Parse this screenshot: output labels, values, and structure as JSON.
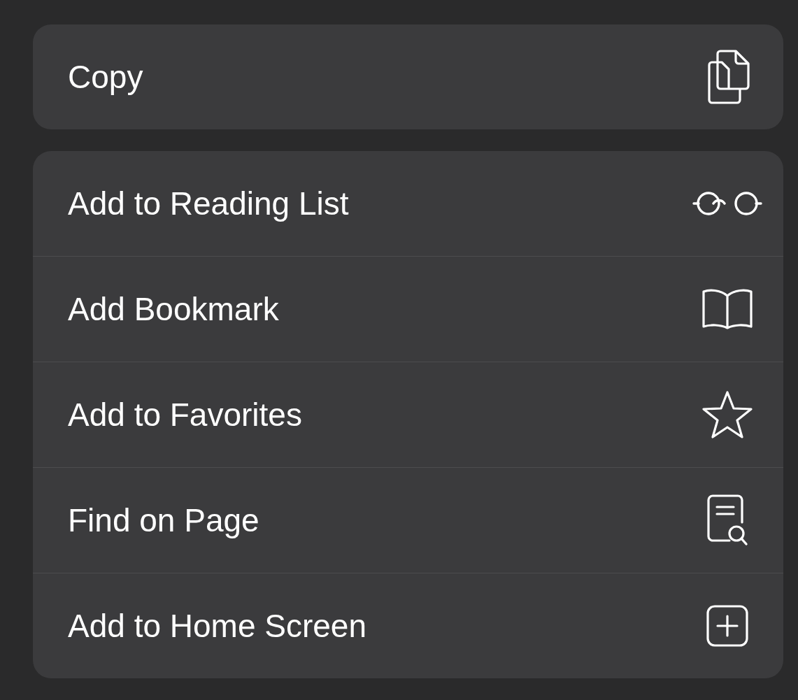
{
  "groups": [
    {
      "items": [
        {
          "label": "Copy",
          "kind": "copy"
        }
      ]
    },
    {
      "items": [
        {
          "label": "Add to Reading List",
          "kind": "glasses"
        },
        {
          "label": "Add Bookmark",
          "kind": "book"
        },
        {
          "label": "Add to Favorites",
          "kind": "star"
        },
        {
          "label": "Find on Page",
          "kind": "find"
        },
        {
          "label": "Add to Home Screen",
          "kind": "add"
        }
      ]
    }
  ]
}
